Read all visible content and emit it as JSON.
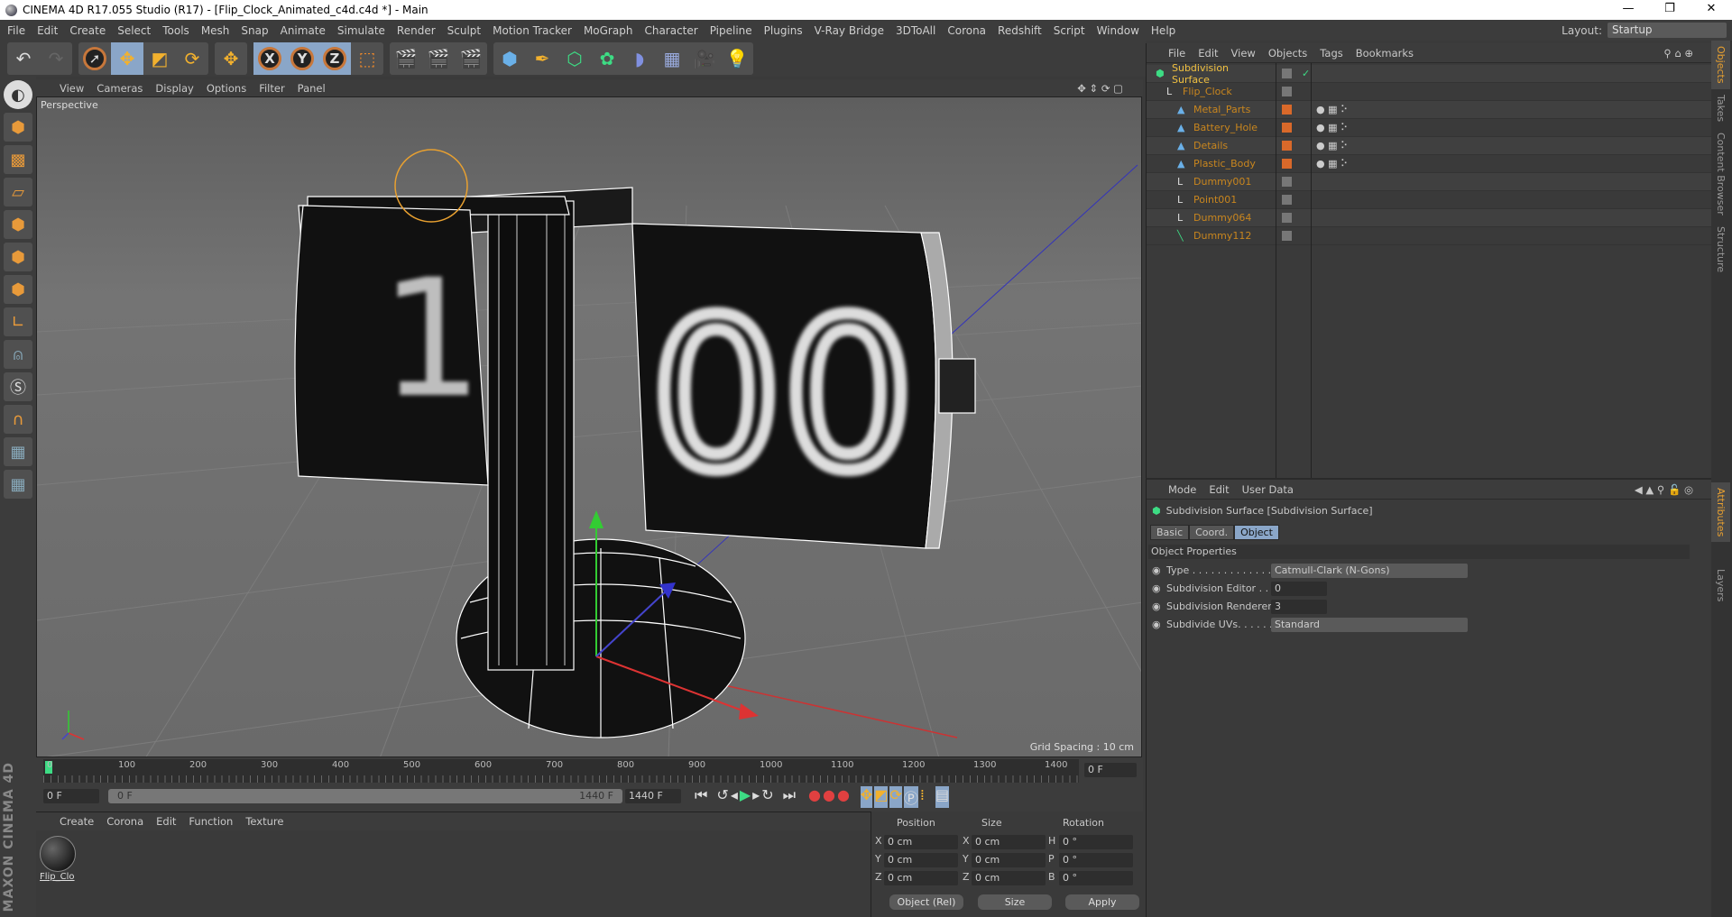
{
  "window": {
    "title": "CINEMA 4D R17.055 Studio (R17) - [Flip_Clock_Animated_c4d.c4d *] - Main",
    "controls": [
      "—",
      "❐",
      "✕"
    ]
  },
  "menu": [
    "File",
    "Edit",
    "Create",
    "Select",
    "Tools",
    "Mesh",
    "Snap",
    "Animate",
    "Simulate",
    "Render",
    "Sculpt",
    "Motion Tracker",
    "MoGraph",
    "Character",
    "Pipeline",
    "Plugins",
    "V-Ray Bridge",
    "3DToAll",
    "Corona",
    "Redshift",
    "Script",
    "Window",
    "Help"
  ],
  "layout": {
    "label": "Layout:",
    "value": "Startup"
  },
  "viewport": {
    "menu": [
      "View",
      "Cameras",
      "Display",
      "Options",
      "Filter",
      "Panel"
    ],
    "label": "Perspective",
    "grid_spacing": "Grid Spacing : 10 cm",
    "digits_left": "1",
    "digits_right": "00"
  },
  "timeline": {
    "ticks": [
      "0",
      "100",
      "200",
      "300",
      "400",
      "500",
      "600",
      "700",
      "800",
      "900",
      "1000",
      "1100",
      "1200",
      "1300",
      "1400"
    ],
    "current": "0 F",
    "start": "0 F",
    "range_start": "0 F",
    "range_end": "1440 F",
    "end": "1440 F",
    "playhead": 0
  },
  "materials": {
    "menu": [
      "Create",
      "Corona",
      "Edit",
      "Function",
      "Texture"
    ],
    "items": [
      {
        "name": "Flip_Clo"
      }
    ]
  },
  "coords": {
    "headers": [
      "Position",
      "Size",
      "Rotation"
    ],
    "rows": [
      {
        "a": "X",
        "p": "0 cm",
        "b": "X",
        "s": "0 cm",
        "c": "H",
        "r": "0 °"
      },
      {
        "a": "Y",
        "p": "0 cm",
        "b": "Y",
        "s": "0 cm",
        "c": "P",
        "r": "0 °"
      },
      {
        "a": "Z",
        "p": "0 cm",
        "b": "Z",
        "s": "0 cm",
        "c": "B",
        "r": "0 °"
      }
    ],
    "mode": "Object (Rel)",
    "size_mode": "Size",
    "apply": "Apply"
  },
  "objects": {
    "menu": [
      "File",
      "Edit",
      "View",
      "Objects",
      "Tags",
      "Bookmarks"
    ],
    "items": [
      {
        "name": "Subdivision Surface",
        "depth": 0,
        "color": "#f0c040"
      },
      {
        "name": "Flip_Clock",
        "depth": 1,
        "color": "#c9861e"
      },
      {
        "name": "Metal_Parts",
        "depth": 2,
        "color": "#c9861e"
      },
      {
        "name": "Battery_Hole",
        "depth": 2,
        "color": "#c9861e"
      },
      {
        "name": "Details",
        "depth": 2,
        "color": "#c9861e"
      },
      {
        "name": "Plastic_Body",
        "depth": 2,
        "color": "#c9861e"
      },
      {
        "name": "Dummy001",
        "depth": 2,
        "color": "#c9861e"
      },
      {
        "name": "Point001",
        "depth": 2,
        "color": "#c9861e"
      },
      {
        "name": "Dummy064",
        "depth": 2,
        "color": "#c9861e"
      },
      {
        "name": "Dummy112",
        "depth": 2,
        "color": "#c9861e"
      }
    ]
  },
  "attributes": {
    "menu": [
      "Mode",
      "Edit",
      "User Data"
    ],
    "title": "Subdivision Surface [Subdivision Surface]",
    "tabs": [
      "Basic",
      "Coord.",
      "Object"
    ],
    "active_tab": "Object",
    "section": "Object Properties",
    "props": [
      {
        "label": "Type . . . . . . . . . . . . . . .",
        "value": "Catmull-Clark (N-Gons)"
      },
      {
        "label": "Subdivision Editor . .",
        "value": "0"
      },
      {
        "label": "Subdivision Renderer",
        "value": "3"
      },
      {
        "label": "Subdivide UVs. . . . . .",
        "value": "Standard"
      }
    ]
  },
  "side_tabs_top": [
    "Objects",
    "Takes",
    "Content Browser",
    "Structure"
  ],
  "side_tabs_bottom": [
    "Attributes",
    "Layers"
  ],
  "brand": "MAXON CINEMA 4D"
}
